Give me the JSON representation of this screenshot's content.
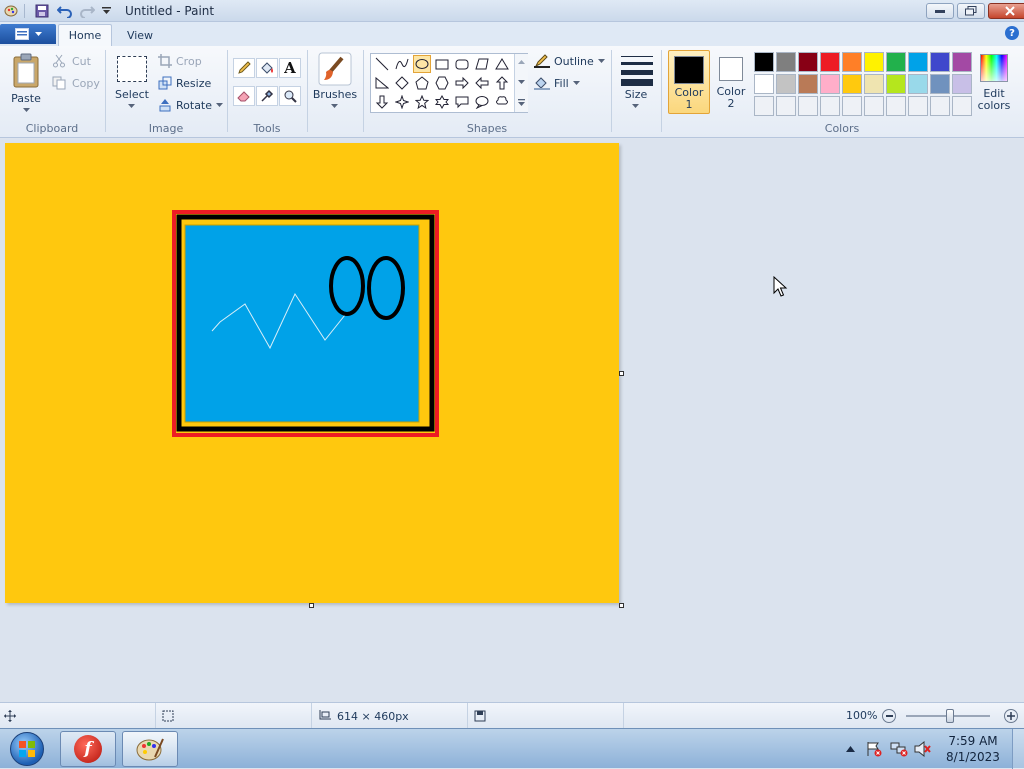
{
  "window": {
    "title": "Untitled - Paint"
  },
  "tabs": [
    {
      "label": "Home"
    },
    {
      "label": "View"
    }
  ],
  "clipboard": {
    "group": "Clipboard",
    "paste": "Paste",
    "cut": "Cut",
    "copy": "Copy"
  },
  "image": {
    "group": "Image",
    "select": "Select",
    "crop": "Crop",
    "resize": "Resize",
    "rotate": "Rotate"
  },
  "tools": {
    "group": "Tools"
  },
  "brushes": {
    "label": "Brushes"
  },
  "shapes": {
    "group": "Shapes",
    "outline": "Outline",
    "fill": "Fill"
  },
  "size": {
    "label": "Size"
  },
  "colors": {
    "group": "Colors",
    "color1_label": "Color",
    "color1_num": "1",
    "color2_label": "Color",
    "color2_num": "2",
    "edit": "Edit",
    "edit2": "colors",
    "color1": "#000000",
    "color2": "#ffffff",
    "palette": [
      "#000000",
      "#7f7f7f",
      "#880015",
      "#ed1c24",
      "#ff7f27",
      "#fff200",
      "#22b14c",
      "#00a2e8",
      "#3f48cc",
      "#a349a4",
      "#ffffff",
      "#c3c3c3",
      "#b97a57",
      "#ffaec9",
      "#ffc90e",
      "#efe4b0",
      "#b5e61d",
      "#99d9ea",
      "#7092be",
      "#c8bfe7"
    ]
  },
  "canvas": {
    "background": "#ffc80e",
    "inner_fill": "#00a2e8",
    "border_outer": "#ed1c24"
  },
  "status": {
    "dimensions": "614 × 460px",
    "zoom": "100%"
  },
  "clock": {
    "time": "7:59 AM",
    "date": "8/1/2023"
  }
}
